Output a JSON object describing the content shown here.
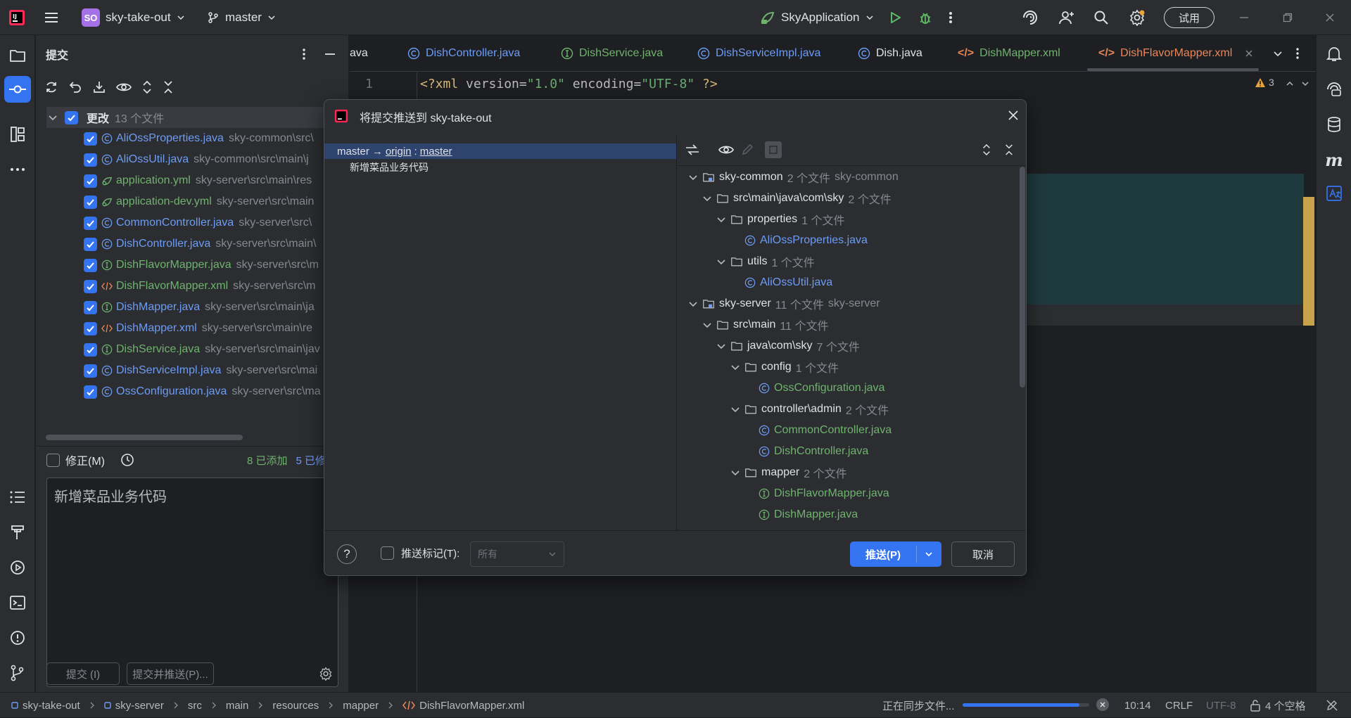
{
  "titlebar": {
    "project_initials": "SO",
    "project_name": "sky-take-out",
    "branch": "master",
    "run_config": "SkyApplication",
    "trial_label": "试用"
  },
  "commit_panel": {
    "title": "提交",
    "changes_label": "更改",
    "changes_count": "13 个文件",
    "files": [
      {
        "name": "AliOssProperties.java",
        "path": "sky-common\\src\\",
        "kind": "class"
      },
      {
        "name": "AliOssUtil.java",
        "path": "sky-common\\src\\main\\j",
        "kind": "class"
      },
      {
        "name": "application.yml",
        "path": "sky-server\\src\\main\\res",
        "kind": "yaml"
      },
      {
        "name": "application-dev.yml",
        "path": "sky-server\\src\\main",
        "kind": "yaml"
      },
      {
        "name": "CommonController.java",
        "path": "sky-server\\src\\",
        "kind": "class"
      },
      {
        "name": "DishController.java",
        "path": "sky-server\\src\\main\\",
        "kind": "class"
      },
      {
        "name": "DishFlavorMapper.java",
        "path": "sky-server\\src\\m",
        "kind": "interface"
      },
      {
        "name": "DishFlavorMapper.xml",
        "path": "sky-server\\src\\m",
        "kind": "xml"
      },
      {
        "name": "DishMapper.java",
        "path": "sky-server\\src\\main\\ja",
        "kind": "interface"
      },
      {
        "name": "DishMapper.xml",
        "path": "sky-server\\src\\main\\re",
        "kind": "xml"
      },
      {
        "name": "DishService.java",
        "path": "sky-server\\src\\main\\jav",
        "kind": "interface"
      },
      {
        "name": "DishServiceImpl.java",
        "path": "sky-server\\src\\mai",
        "kind": "class"
      },
      {
        "name": "OssConfiguration.java",
        "path": "sky-server\\src\\ma",
        "kind": "class"
      }
    ],
    "amend_label": "修正(M)",
    "added_stat": "8 已添加",
    "modified_stat": "5 已修",
    "message": "新增菜品业务代码",
    "commit_button": "提交 (I)",
    "commit_push_button": "提交并推送(P)..."
  },
  "editor": {
    "tabs": [
      {
        "label": "ava",
        "kind": "none"
      },
      {
        "label": "DishController.java",
        "kind": "class"
      },
      {
        "label": "DishService.java",
        "kind": "interface"
      },
      {
        "label": "DishServiceImpl.java",
        "kind": "class"
      },
      {
        "label": "Dish.java",
        "kind": "class"
      },
      {
        "label": "DishMapper.xml",
        "kind": "xml"
      },
      {
        "label": "DishFlavorMapper.xml",
        "kind": "xml"
      }
    ],
    "line_number": "1",
    "code": {
      "open": "<?xml ",
      "attr1": "version=",
      "val1": "\"1.0\"",
      "attr2": " encoding=",
      "val2": "\"UTF-8\"",
      "close": " ?>"
    },
    "warning_count": "3"
  },
  "dialog": {
    "title": "将提交推送到 sky-take-out",
    "branch_from": "master",
    "arrow": "→",
    "remote": "origin",
    "sep": ":",
    "branch_to": "master",
    "commit_message": "新增菜品业务代码",
    "tree": [
      {
        "label": "sky-common",
        "count": "2 个文件",
        "extra": "sky-common",
        "type": "module",
        "expanded": true
      },
      {
        "label": "src\\main\\java\\com\\sky",
        "count": "2 个文件",
        "type": "folder",
        "expanded": true
      },
      {
        "label": "properties",
        "count": "1 个文件",
        "type": "folder",
        "expanded": true
      },
      {
        "label": "AliOssProperties.java",
        "type": "class"
      },
      {
        "label": "utils",
        "count": "1 个文件",
        "type": "folder",
        "expanded": true
      },
      {
        "label": "AliOssUtil.java",
        "type": "class"
      },
      {
        "label": "sky-server",
        "count": "11 个文件",
        "extra": "sky-server",
        "type": "module",
        "expanded": true
      },
      {
        "label": "src\\main",
        "count": "11 个文件",
        "type": "folder",
        "expanded": true
      },
      {
        "label": "java\\com\\sky",
        "count": "7 个文件",
        "type": "folder",
        "expanded": true
      },
      {
        "label": "config",
        "count": "1 个文件",
        "type": "folder",
        "expanded": true
      },
      {
        "label": "OssConfiguration.java",
        "type": "class-green"
      },
      {
        "label": "controller\\admin",
        "count": "2 个文件",
        "type": "folder",
        "expanded": true
      },
      {
        "label": "CommonController.java",
        "type": "class-green"
      },
      {
        "label": "DishController.java",
        "type": "class-green"
      },
      {
        "label": "mapper",
        "count": "2 个文件",
        "type": "folder",
        "expanded": true
      },
      {
        "label": "DishFlavorMapper.java",
        "type": "interface"
      },
      {
        "label": "DishMapper.java",
        "type": "interface"
      }
    ],
    "push_tags_label": "推送标记(T):",
    "tags_select_value": "所有",
    "push_button": "推送(P)",
    "cancel_button": "取消",
    "help_label": "?"
  },
  "statusbar": {
    "breadcrumb": [
      "sky-take-out",
      "sky-server",
      "src",
      "main",
      "resources",
      "mapper",
      "DishFlavorMapper.xml"
    ],
    "sync_text": "正在同步文件...",
    "progress": 0.92,
    "position": "10:14",
    "line_sep": "CRLF",
    "encoding": "UTF-8",
    "indent": "4 个空格"
  },
  "colors": {
    "accent": "#3574f0",
    "class_blue": "#6d9cf5",
    "added_green": "#6fb36f",
    "xml_orange": "#e8865a",
    "warning": "#e8a33d"
  }
}
